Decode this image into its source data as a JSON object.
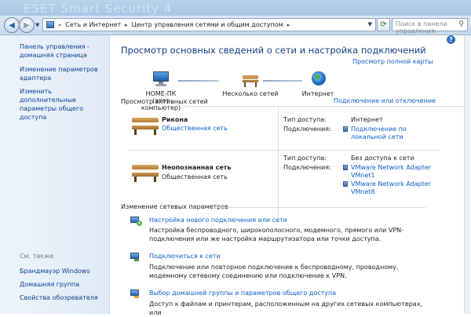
{
  "window": {
    "title_ghost": "ESET Smart Security 4"
  },
  "address_bar": {
    "crumb_prefix": "«",
    "crumbs": [
      "Сеть и Интернет",
      "Центр управления сетями и общим доступом"
    ],
    "separator": "▸"
  },
  "search": {
    "placeholder": "Поиск в панели управления"
  },
  "sidebar": {
    "home": "Панель управления - домашняя страница",
    "adapter": "Изменение параметров адаптера",
    "sharing": "Изменить дополнительные параметры общего доступа",
    "see_also": "См. также",
    "firewall": "Брандмауэр Windows",
    "homegroup": "Домашняя группа",
    "browser": "Свойства обозревателя"
  },
  "main": {
    "help": "?",
    "title": "Просмотр основных сведений о сети и настройка подключений",
    "view_full_map": "Просмотр полной карты",
    "map": {
      "pc_name": "HOME-ПК",
      "pc_sub": "(этот компьютер)",
      "multi": "Несколько сетей",
      "internet": "Интернет"
    },
    "active_heading": "Просмотр активных сетей",
    "connect_disconnect": "Подключение или отключение",
    "networks": [
      {
        "name": "Рикона",
        "type": "Общественная сеть",
        "access_label": "Тип доступа:",
        "access_value": "Интернет",
        "conn_label": "Подключения:",
        "connections": [
          "Подключение по",
          "локальной сети"
        ]
      },
      {
        "name": "Неопознанная сеть",
        "type": "Общественная сеть",
        "access_label": "Тип доступа:",
        "access_value": "Без доступа к сети",
        "conn_label": "Подключения:",
        "connections": [
          "VMware Network Adapter",
          "VMnet1",
          "VMware Network Adapter",
          "VMnet8"
        ]
      }
    ],
    "change_heading": "Изменение сетевых параметров",
    "tasks": [
      {
        "link": "Настройка нового подключения или сети",
        "desc": "Настройка беспроводного, широкополосного, модемного, прямого или VPN-подключения или же настройка маршрутизатора или точки доступа."
      },
      {
        "link": "Подключиться к сети",
        "desc": "Подключение или повторное подключение к беспроводному, проводному, модемному сетевому соединению или подключение к VPN."
      },
      {
        "link": "Выбор домашней группы и параметров общего доступа",
        "desc": "Доступ к файлам и принтерам, расположенным на других сетевых компьютерах, или"
      }
    ]
  },
  "colors": {
    "link": "#0b5fc4",
    "title": "#123e87",
    "sidebar_bg": "#dfeaf6"
  }
}
